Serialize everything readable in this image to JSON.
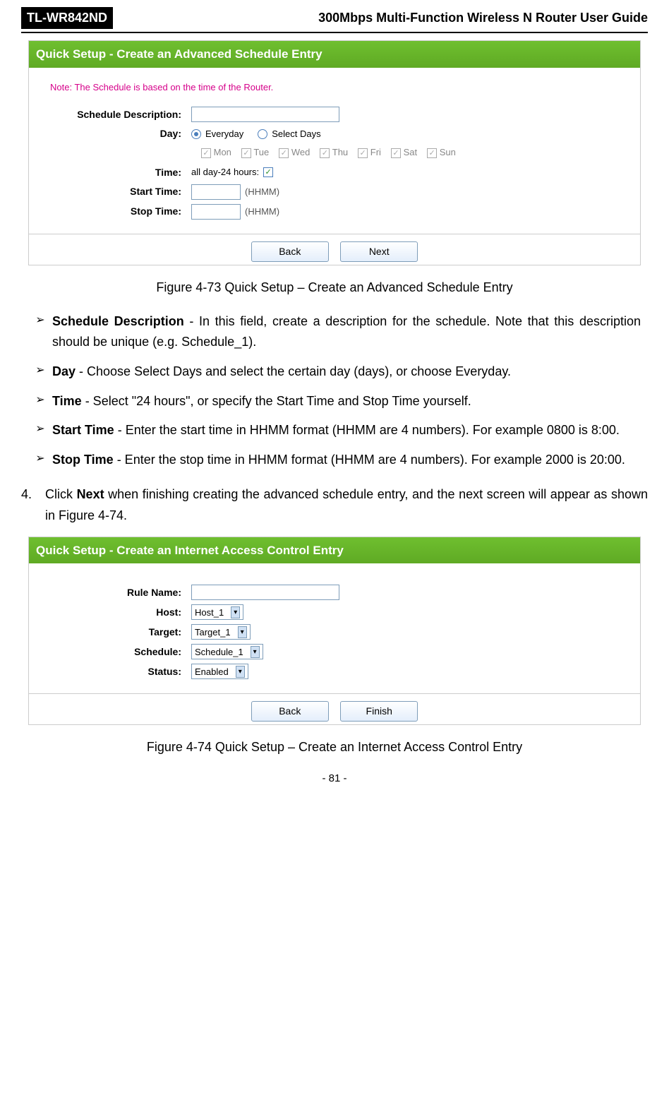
{
  "header": {
    "model": "TL-WR842ND",
    "title": "300Mbps Multi-Function Wireless N Router User Guide"
  },
  "panel1": {
    "title": "Quick Setup - Create an Advanced Schedule Entry",
    "note": "Note: The Schedule is based on the time of the Router.",
    "labels": {
      "schedule_desc": "Schedule Description:",
      "day": "Day:",
      "time": "Time:",
      "start_time": "Start Time:",
      "stop_time": "Stop Time:"
    },
    "day_options": {
      "everyday": "Everyday",
      "select_days": "Select Days"
    },
    "days": {
      "mon": "Mon",
      "tue": "Tue",
      "wed": "Wed",
      "thu": "Thu",
      "fri": "Fri",
      "sat": "Sat",
      "sun": "Sun"
    },
    "time_all_day": "all day-24 hours:",
    "hhmm": "(HHMM)",
    "buttons": {
      "back": "Back",
      "next": "Next"
    }
  },
  "caption1": "Figure 4-73    Quick Setup – Create an Advanced Schedule Entry",
  "bullets": [
    {
      "bold": "Schedule Description",
      "text": " - In this field, create a description for the schedule. Note that this description should be unique (e.g. Schedule_1)."
    },
    {
      "bold": "Day",
      "text": " - Choose Select Days and select the certain day (days), or choose Everyday."
    },
    {
      "bold": "Time",
      "text": " - Select \"24 hours\", or specify the Start Time and Stop Time yourself."
    },
    {
      "bold": "Start Time",
      "text": " - Enter the start time in HHMM format (HHMM are 4 numbers). For example 0800 is 8:00."
    },
    {
      "bold": "Stop Time",
      "text": " - Enter the stop time in HHMM format (HHMM are 4 numbers). For example 2000 is 20:00."
    }
  ],
  "step4": {
    "num": "4.",
    "pre": "Click ",
    "bold": "Next",
    "post": " when finishing creating the advanced schedule entry, and the next screen will appear as shown in Figure 4-74."
  },
  "panel2": {
    "title": "Quick Setup - Create an Internet Access Control Entry",
    "labels": {
      "rule_name": "Rule Name:",
      "host": "Host:",
      "target": "Target:",
      "schedule": "Schedule:",
      "status": "Status:"
    },
    "values": {
      "host": "Host_1",
      "target": "Target_1",
      "schedule": "Schedule_1",
      "status": "Enabled"
    },
    "buttons": {
      "back": "Back",
      "finish": "Finish"
    }
  },
  "caption2": "Figure 4-74    Quick Setup – Create an Internet Access Control Entry",
  "page_number": "- 81 -"
}
